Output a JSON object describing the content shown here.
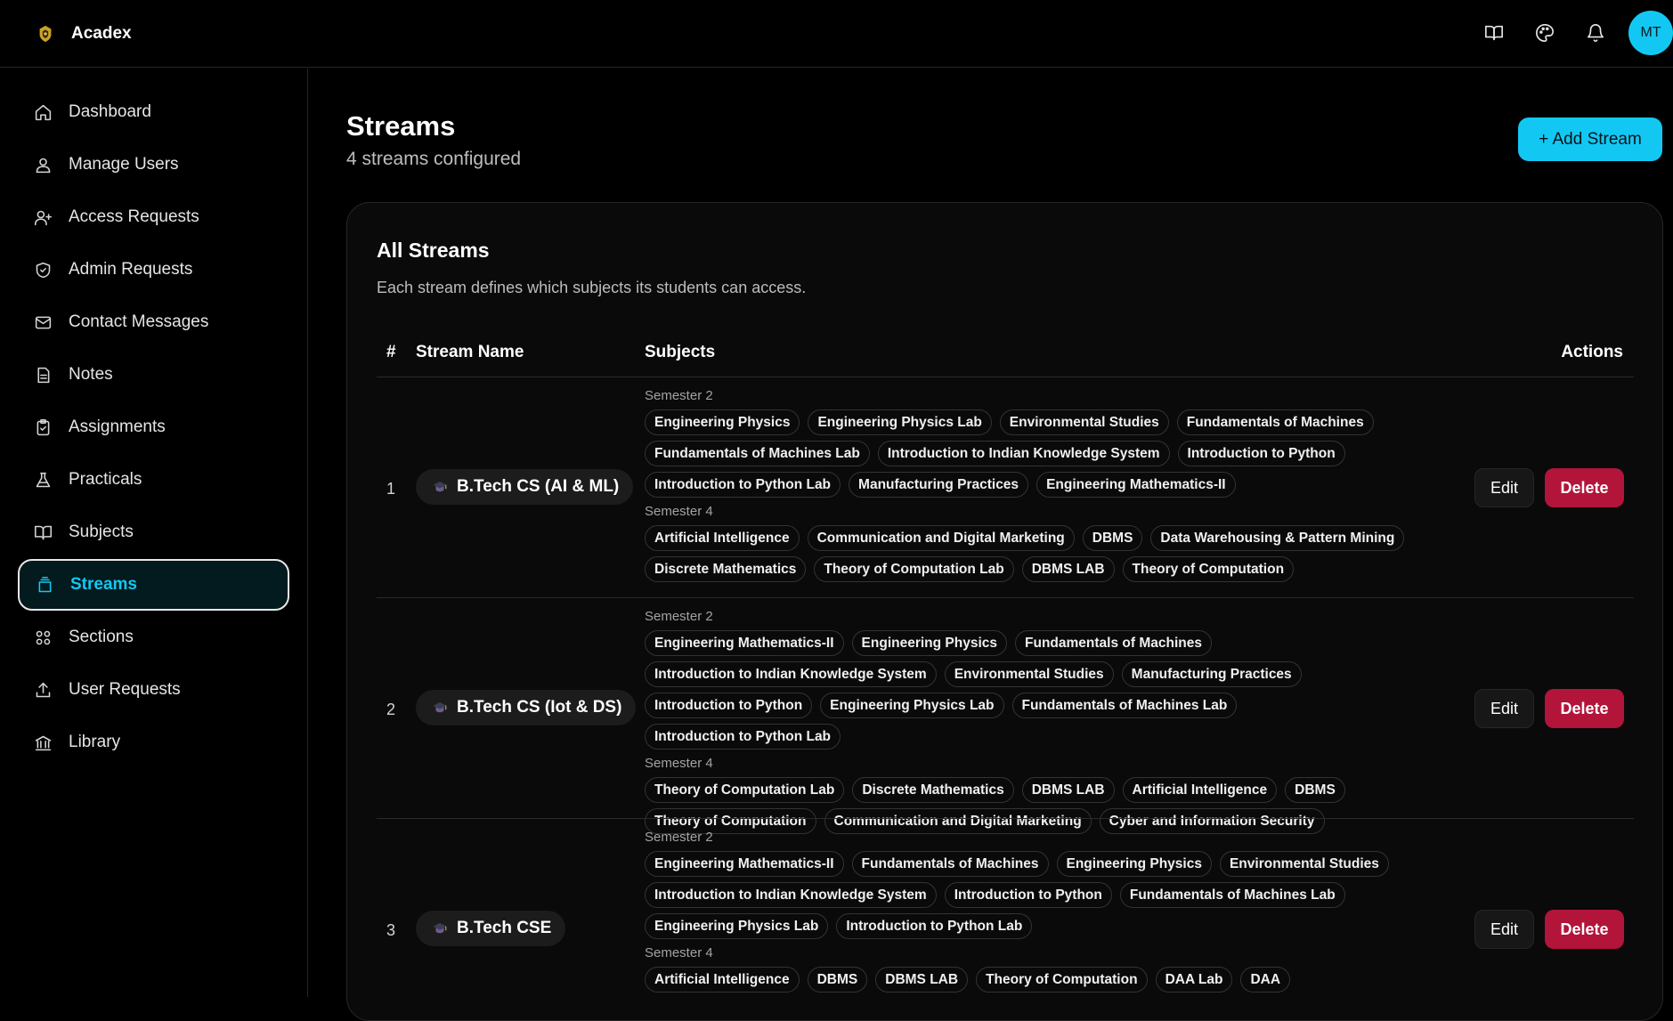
{
  "app": {
    "name": "Acadex",
    "avatar_initials": "MT",
    "accent": "#12c8f3",
    "danger": "#b3143a"
  },
  "topbar": {
    "icons": [
      "book-icon",
      "palette-icon",
      "bell-icon"
    ]
  },
  "sidebar": {
    "items": [
      {
        "label": "Dashboard",
        "icon": "home-icon"
      },
      {
        "label": "Manage Users",
        "icon": "users-icon"
      },
      {
        "label": "Access Requests",
        "icon": "user-plus-icon"
      },
      {
        "label": "Admin Requests",
        "icon": "shield-icon"
      },
      {
        "label": "Contact Messages",
        "icon": "mail-icon"
      },
      {
        "label": "Notes",
        "icon": "document-icon"
      },
      {
        "label": "Assignments",
        "icon": "clipboard-icon"
      },
      {
        "label": "Practicals",
        "icon": "flask-icon"
      },
      {
        "label": "Subjects",
        "icon": "book-open-icon"
      },
      {
        "label": "Streams",
        "icon": "layers-icon",
        "active": true
      },
      {
        "label": "Sections",
        "icon": "grid-icon"
      },
      {
        "label": "User Requests",
        "icon": "upload-icon"
      },
      {
        "label": "Library",
        "icon": "library-icon"
      }
    ]
  },
  "header": {
    "title": "Streams",
    "subtitle": "4 streams configured",
    "add_label": "+ Add Stream"
  },
  "card": {
    "title": "All Streams",
    "description": "Each stream defines which subjects its students can access."
  },
  "table": {
    "columns": {
      "num": "#",
      "name": "Stream Name",
      "subjects": "Subjects",
      "actions": "Actions"
    },
    "edit_label": "Edit",
    "delete_label": "Delete",
    "rows": [
      {
        "num": "1",
        "name": "B.Tech CS (AI & ML)",
        "semesters": [
          {
            "label": "Semester 2",
            "subjects": [
              "Engineering Physics",
              "Engineering Physics Lab",
              "Environmental Studies",
              "Fundamentals of Machines",
              "Fundamentals of Machines Lab",
              "Introduction to Indian Knowledge System",
              "Introduction to Python",
              "Introduction to Python Lab",
              "Manufacturing Practices",
              "Engineering Mathematics-II"
            ]
          },
          {
            "label": "Semester 4",
            "subjects": [
              "Artificial Intelligence",
              "Communication and Digital Marketing",
              "DBMS",
              "Data Warehousing & Pattern Mining",
              "Discrete Mathematics",
              "Theory of Computation Lab",
              "DBMS LAB",
              "Theory of Computation"
            ]
          }
        ]
      },
      {
        "num": "2",
        "name": "B.Tech CS (Iot & DS)",
        "semesters": [
          {
            "label": "Semester 2",
            "subjects": [
              "Engineering Mathematics-II",
              "Engineering Physics",
              "Fundamentals of Machines",
              "Introduction to Indian Knowledge System",
              "Environmental Studies",
              "Manufacturing Practices",
              "Introduction to Python",
              "Engineering Physics Lab",
              "Fundamentals of Machines Lab",
              "Introduction to Python Lab"
            ]
          },
          {
            "label": "Semester 4",
            "subjects": [
              "Theory of Computation Lab",
              "Discrete Mathematics",
              "DBMS LAB",
              "Artificial Intelligence",
              "DBMS",
              "Theory of Computation",
              "Communication and Digital Marketing",
              "Cyber and Information Security"
            ]
          }
        ]
      },
      {
        "num": "3",
        "name": "B.Tech CSE",
        "semesters": [
          {
            "label": "Semester 2",
            "subjects": [
              "Engineering Mathematics-II",
              "Fundamentals of Machines",
              "Engineering Physics",
              "Environmental Studies",
              "Introduction to Indian Knowledge System",
              "Introduction to Python",
              "Fundamentals of Machines Lab",
              "Engineering Physics Lab",
              "Introduction to Python Lab"
            ]
          },
          {
            "label": "Semester 4",
            "subjects": [
              "Artificial Intelligence",
              "DBMS",
              "DBMS LAB",
              "Theory of Computation",
              "DAA Lab",
              "DAA"
            ]
          }
        ]
      }
    ]
  }
}
